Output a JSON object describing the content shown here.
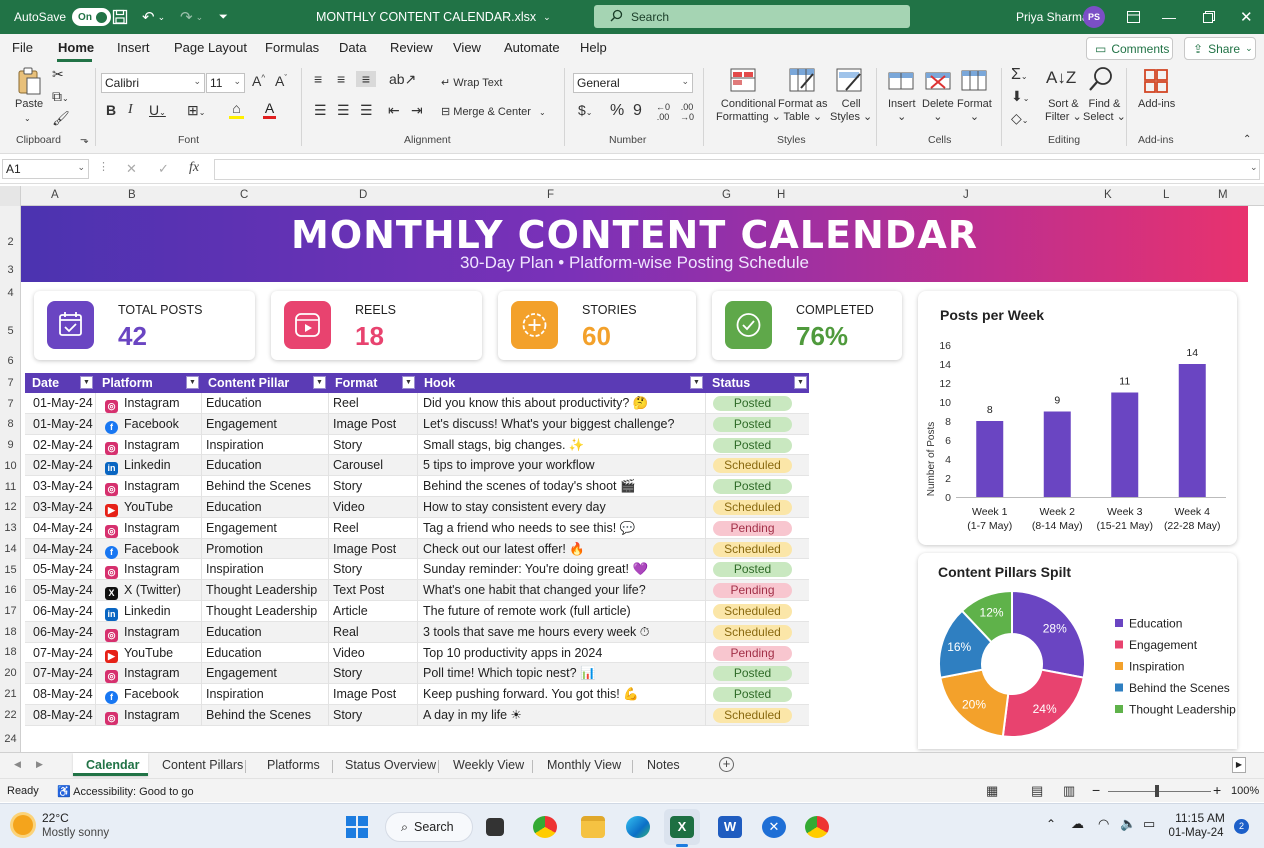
{
  "window": {
    "autosave_label": "AutoSave",
    "autosave_state": "On",
    "filename": "MONTHLY CONTENT CALENDAR.xlsx",
    "search_placeholder": "Search",
    "user_name": "Priya Sharma",
    "user_initials": "PS"
  },
  "menu": {
    "items": [
      "File",
      "Home",
      "Insert",
      "Page Layout",
      "Formulas",
      "Data",
      "Review",
      "View",
      "Automate",
      "Help"
    ],
    "active": "Home",
    "comments_label": "Comments",
    "share_label": "Share"
  },
  "ribbon": {
    "clipboard": {
      "paste": "Paste",
      "group": "Clipboard"
    },
    "font": {
      "name": "Calibri",
      "size": "11",
      "group": "Font"
    },
    "alignment": {
      "wrap": "Wrap Text",
      "merge": "Merge & Center",
      "group": "Alignment"
    },
    "number": {
      "format": "General",
      "group": "Number"
    },
    "styles": {
      "conditional1": "Conditional",
      "conditional2": "Formatting",
      "format_table1": "Format as",
      "format_table2": "Table",
      "cell_styles1": "Cell",
      "cell_styles2": "Styles",
      "group": "Styles"
    },
    "cells": {
      "insert": "Insert",
      "delete": "Delete",
      "format": "Format",
      "group": "Cells"
    },
    "editing": {
      "sort1": "Sort &",
      "sort2": "Filter",
      "find1": "Find &",
      "find2": "Select",
      "group": "Editing"
    },
    "addins": {
      "label": "Add-ins",
      "group": "Add-ins"
    }
  },
  "formula_bar": {
    "name_box": "A1",
    "fx": "fx",
    "formula": ""
  },
  "columns": [
    "A",
    "B",
    "C",
    "D",
    "F",
    "G",
    "H",
    "J",
    "K",
    "L",
    "M"
  ],
  "rows": [
    "2",
    "3",
    "4",
    "5",
    "6",
    "7",
    "7",
    "8",
    "9",
    "10",
    "11",
    "12",
    "13",
    "14",
    "15",
    "16",
    "17",
    "18",
    "18",
    "20",
    "21",
    "22",
    "24"
  ],
  "banner": {
    "title": "MONTHLY CONTENT CALENDAR",
    "subtitle": "30-Day Plan  •  Platform-wise Posting Schedule"
  },
  "kpis": [
    {
      "label": "TOTAL POSTS",
      "value": "42",
      "color": "#6a45c2",
      "icon": "calendar-check-icon"
    },
    {
      "label": "REELS",
      "value": "18",
      "color": "#e8436f",
      "icon": "play-icon"
    },
    {
      "label": "STORIES",
      "value": "60",
      "color": "#f3a12b",
      "icon": "plus-circle-icon"
    },
    {
      "label": "COMPLETED",
      "value": "76%",
      "color": "#5fa84a",
      "icon": "check-circle-icon"
    }
  ],
  "table": {
    "headers": [
      "Date",
      "Platform",
      "Content Pillar",
      "Format",
      "Hook",
      "Status"
    ],
    "rows": [
      {
        "date": "01-May-24",
        "platform": "Instagram",
        "pillar": "Education",
        "format": "Reel",
        "hook": "Did you know this about productivity? 🤔",
        "status": "Posted"
      },
      {
        "date": "01-May-24",
        "platform": "Facebook",
        "pillar": "Engagement",
        "format": "Image Post",
        "hook": "Let's discuss! What's your biggest challenge?",
        "status": "Posted"
      },
      {
        "date": "02-May-24",
        "platform": "Instagram",
        "pillar": "Inspiration",
        "format": "Story",
        "hook": "Small stags, big changes. ✨",
        "status": "Posted"
      },
      {
        "date": "02-May-24",
        "platform": "Linkedin",
        "pillar": "Education",
        "format": "Carousel",
        "hook": "5 tips to improve your workflow",
        "status": "Scheduled"
      },
      {
        "date": "03-May-24",
        "platform": "Instagram",
        "pillar": "Behind the Scenes",
        "format": "Story",
        "hook": "Behind the scenes of today's shoot 🎬",
        "status": "Posted"
      },
      {
        "date": "03-May-24",
        "platform": "YouTube",
        "pillar": "Education",
        "format": "Video",
        "hook": "How to stay consistent every day",
        "status": "Scheduled"
      },
      {
        "date": "04-May-24",
        "platform": "Instagram",
        "pillar": "Engagement",
        "format": "Reel",
        "hook": "Tag a friend who needs to see this! 💬",
        "status": "Pending"
      },
      {
        "date": "04-May-24",
        "platform": "Facebook",
        "pillar": "Promotion",
        "format": "Image Post",
        "hook": "Check out our latest offer! 🔥",
        "status": "Scheduled"
      },
      {
        "date": "05-May-24",
        "platform": "Instagram",
        "pillar": "Inspiration",
        "format": "Story",
        "hook": "Sunday reminder: You're doing great! 💜",
        "status": "Posted"
      },
      {
        "date": "05-May-24",
        "platform": "X (Twitter)",
        "pillar": "Thought Leadership",
        "format": "Text Post",
        "hook": "What's one habit that changed your life?",
        "status": "Pending"
      },
      {
        "date": "06-May-24",
        "platform": "Linkedin",
        "pillar": "Thought Leadership",
        "format": "Article",
        "hook": "The future of remote work (full article)",
        "status": "Scheduled"
      },
      {
        "date": "06-May-24",
        "platform": "Instagram",
        "pillar": "Education",
        "format": "Real",
        "hook": "3 tools that save me hours every week ⏱",
        "status": "Scheduled"
      },
      {
        "date": "07-May-24",
        "platform": "YouTube",
        "pillar": "Education",
        "format": "Video",
        "hook": "Top 10 productivity apps in 2024",
        "status": "Pending"
      },
      {
        "date": "07-May-24",
        "platform": "Instagram",
        "pillar": "Engagement",
        "format": "Story",
        "hook": "Poll time! Which topic nest? 📊",
        "status": "Posted"
      },
      {
        "date": "08-May-24",
        "platform": "Facebook",
        "pillar": "Inspiration",
        "format": "Image Post",
        "hook": "Keep pushing forward. You got this! 💪",
        "status": "Posted"
      },
      {
        "date": "08-May-24",
        "platform": "Instagram",
        "pillar": "Behind the Scenes",
        "format": "Story",
        "hook": "A day in my life ☀",
        "status": "Scheduled"
      }
    ]
  },
  "status_colors": {
    "Posted": {
      "bg": "#c9e8c0",
      "fg": "#2f6b28"
    },
    "Scheduled": {
      "bg": "#fbe6a8",
      "fg": "#8a6a10"
    },
    "Pending": {
      "bg": "#f8c6cf",
      "fg": "#a23048"
    }
  },
  "platform_colors": {
    "Instagram": "#d6306e",
    "Facebook": "#1877f2",
    "Linkedin": "#0a66c2",
    "YouTube": "#e62117",
    "X (Twitter)": "#111111"
  },
  "chart_data": [
    {
      "type": "bar",
      "title": "Posts per Week",
      "ylabel": "Number of Posts",
      "categories": [
        "Week 1\n(1-7 May)",
        "Week 2\n(8-14 May)",
        "Week 3\n(15-21 May)",
        "Week 4\n(22-28 May)"
      ],
      "values": [
        8,
        9,
        11,
        14
      ],
      "ylim": [
        0,
        16
      ],
      "yticks": [
        0,
        2,
        4,
        6,
        8,
        10,
        12,
        14,
        16
      ],
      "color": "#6a45c2",
      "grid": false
    },
    {
      "type": "pie",
      "title": "Content Pillars Spilt",
      "donut": true,
      "slices": [
        {
          "name": "Education",
          "value": 28,
          "label": "28%",
          "color": "#6a45c2"
        },
        {
          "name": "Engagement",
          "value": 24,
          "label": "24%",
          "color": "#e8436f"
        },
        {
          "name": "Inspiration",
          "value": 20,
          "label": "20%",
          "color": "#f3a12b"
        },
        {
          "name": "Behind the Scenes",
          "value": 16,
          "label": "16%",
          "color": "#2f7fc1"
        },
        {
          "name": "Thought Leadership",
          "value": 12,
          "label": "12%",
          "color": "#5fb24a"
        }
      ],
      "legend": "right"
    }
  ],
  "sheet_tabs": [
    "Calendar",
    "Content Pillars",
    "Platforms",
    "Status Overview",
    "Weekly View",
    "Monthly View",
    "Notes"
  ],
  "active_tab": "Calendar",
  "status_bar": {
    "ready": "Ready",
    "accessibility": "Accessibility: Good to go",
    "zoom": "100%"
  },
  "taskbar": {
    "temp": "22°C",
    "weather": "Mostly sonny",
    "search": "Search",
    "time": "11:15 AM",
    "date": "01-May-24",
    "badge": "2"
  }
}
